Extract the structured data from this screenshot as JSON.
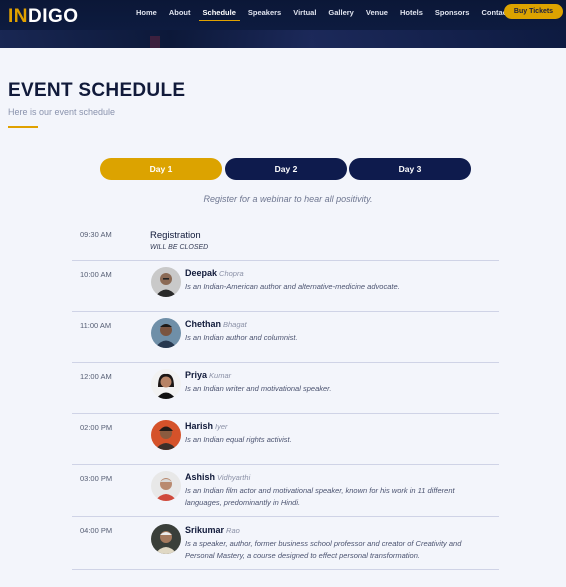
{
  "header": {
    "logo_part1": "IN",
    "logo_part2": "DIGO",
    "nav": [
      "Home",
      "About",
      "Schedule",
      "Speakers",
      "Virtual",
      "Gallery",
      "Venue",
      "Hotels",
      "Sponsors",
      "Contact"
    ],
    "active_nav": "Schedule",
    "buy_label": "Buy Tickets"
  },
  "page": {
    "title": "EVENT SCHEDULE",
    "subtitle": "Here is our event schedule"
  },
  "days": [
    "Day 1",
    "Day 2",
    "Day 3"
  ],
  "active_day": "Day 1",
  "intro": "Register for a webinar to hear all positivity.",
  "registration": {
    "time": "09:30 AM",
    "title": "Registration",
    "subtitle": "WILL BE CLOSED"
  },
  "sessions": [
    {
      "time": "10:00 AM",
      "first": "Deepak",
      "last": "Chopra",
      "desc": "Is an Indian-American author and alternative-medicine advocate."
    },
    {
      "time": "11:00 AM",
      "first": "Chethan",
      "last": "Bhagat",
      "desc": "Is an Indian author and columnist."
    },
    {
      "time": "12:00 AM",
      "first": "Priya",
      "last": "Kumar",
      "desc": "Is an Indian writer and motivational speaker."
    },
    {
      "time": "02:00 PM",
      "first": "Harish",
      "last": "Iyer",
      "desc": "Is an Indian equal rights activist."
    },
    {
      "time": "03:00 PM",
      "first": "Ashish",
      "last": "Vidhyarthi",
      "desc": "Is an Indian film actor and motivational speaker, known for his work in 11 different languages, predominantly in Hindi."
    },
    {
      "time": "04:00 PM",
      "first": "Srikumar",
      "last": "Rao",
      "desc": "Is a speaker, author, former business school professor and creator of Creativity and Personal Mastery, a course designed to effect personal transformation."
    }
  ],
  "colors": {
    "accent": "#dca300",
    "navy": "#0e1b4d",
    "background": "#f3f5fb"
  }
}
